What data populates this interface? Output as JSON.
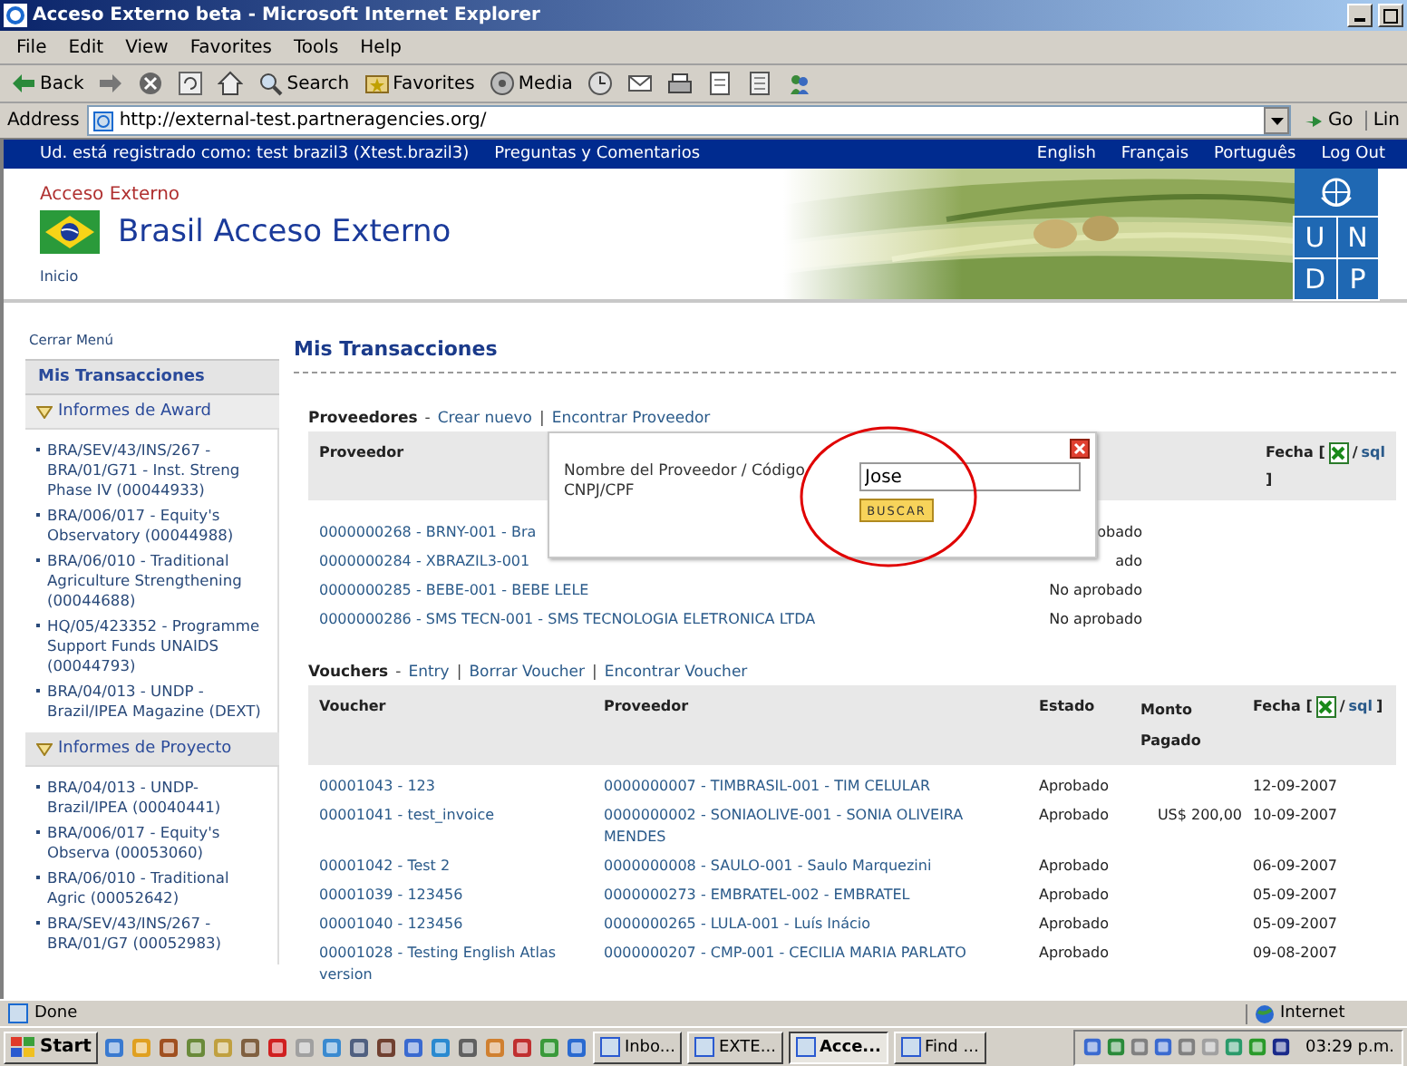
{
  "window": {
    "title": "Acceso Externo beta - Microsoft Internet Explorer"
  },
  "menu": [
    "File",
    "Edit",
    "View",
    "Favorites",
    "Tools",
    "Help"
  ],
  "toolbar": [
    {
      "kind": "back",
      "label": "Back"
    },
    {
      "kind": "forward"
    },
    {
      "kind": "stop"
    },
    {
      "kind": "refresh"
    },
    {
      "kind": "home"
    },
    {
      "kind": "search",
      "label": "Search"
    },
    {
      "kind": "favorites",
      "label": "Favorites"
    },
    {
      "kind": "media",
      "label": "Media"
    },
    {
      "kind": "history"
    },
    {
      "kind": "mail"
    },
    {
      "kind": "print"
    },
    {
      "kind": "edit"
    },
    {
      "kind": "discuss"
    },
    {
      "kind": "messenger"
    }
  ],
  "address": {
    "label": "Address",
    "url": "http://external-test.partneragencies.org/",
    "go": "Go",
    "links": "Lin"
  },
  "topnav": {
    "user": "Ud. está registrado como: test brazil3 (Xtest.brazil3)",
    "help": "Preguntas y Comentarios",
    "links": [
      "English",
      "Français",
      "Português",
      "Log Out"
    ]
  },
  "header": {
    "subtitle": "Acceso Externo",
    "title": "Brasil Acceso Externo",
    "breadcrumb": "Inicio",
    "logo": [
      "U",
      "N",
      "D",
      "P"
    ]
  },
  "sidebar": {
    "toggle": "Cerrar Menú",
    "title": "Mis Transacciones",
    "sections": [
      {
        "title": "Informes de Award",
        "expanded": true,
        "items": [
          "BRA/SEV/43/INS/267 - BRA/01/G71 - Inst. Streng Phase IV (00044933)",
          "BRA/006/017 - Equity's Observatory (00044988)",
          "BRA/06/010 - Traditional Agriculture Strengthening (00044688)",
          "HQ/05/423352 - Programme Support Funds UNAIDS (00044793)",
          "BRA/04/013 - UNDP - Brazil/IPEA Magazine (DEXT)"
        ]
      },
      {
        "title": "Informes de Proyecto",
        "expanded": true,
        "items": [
          "BRA/04/013 - UNDP-Brazil/IPEA (00040441)",
          "BRA/006/017 - Equity's Observa (00053060)",
          "BRA/06/010 - Traditional Agric (00052642)",
          "BRA/SEV/43/INS/267 - BRA/01/G7 (00052983)"
        ]
      }
    ]
  },
  "page_title": "Mis Transacciones",
  "vendors": {
    "title": "Proveedores",
    "dash": "-",
    "separator": "|",
    "links": [
      "Crear nuevo",
      "Encontrar Proveedor"
    ],
    "columns": {
      "vendor": "Proveedor",
      "date": "Fecha [",
      "date_sep": "/",
      "sql": "sql",
      "date_end": "]"
    },
    "rows": [
      {
        "vendor": "0000000268 - BRNY-001 - Bra",
        "status": "obado"
      },
      {
        "vendor": "0000000284 - XBRAZIL3-001",
        "status": "ado"
      },
      {
        "vendor": "0000000285 - BEBE-001 - BEBE LELE",
        "status": "No aprobado"
      },
      {
        "vendor": "0000000286 - SMS TECN-001 - SMS TECNOLOGIA ELETRONICA LTDA",
        "status": "No aprobado"
      }
    ]
  },
  "vouchers": {
    "title": "Vouchers",
    "dash": "-",
    "separator": "|",
    "links": [
      "Entry",
      "Borrar Voucher",
      "Encontrar Voucher"
    ],
    "columns": {
      "voucher": "Voucher",
      "vendor": "Proveedor",
      "status": "Estado",
      "amount": "Monto Pagado",
      "date": "Fecha [",
      "date_sep": "/",
      "sql": "sql",
      "date_end": "]"
    },
    "rows": [
      {
        "voucher": "00001043 - 123",
        "vendor": "0000000007 - TIMBRASIL-001 - TIM CELULAR",
        "status": "Aprobado",
        "date": "12-09-2007"
      },
      {
        "voucher": "00001041 - test_invoice",
        "vendor": "0000000002 - SONIAOLIVE-001 - SONIA OLIVEIRA MENDES",
        "status": "Aprobado",
        "amount": "US$ 200,00",
        "date": "10-09-2007"
      },
      {
        "voucher": "00001042 - Test 2",
        "vendor": "0000000008 - SAULO-001 - Saulo Marquezini",
        "status": "Aprobado",
        "date": "06-09-2007"
      },
      {
        "voucher": "00001039 - 123456",
        "vendor": "0000000273 - EMBRATEL-002 - EMBRATEL",
        "status": "Aprobado",
        "date": "05-09-2007"
      },
      {
        "voucher": "00001040 - 123456",
        "vendor": "0000000265 - LULA-001 - Luís Inácio",
        "status": "Aprobado",
        "date": "05-09-2007"
      },
      {
        "voucher": "00001028 - Testing English Atlas version",
        "vendor": "0000000207 - CMP-001 - CECILIA MARIA PARLATO",
        "status": "Aprobado",
        "date": "09-08-2007"
      }
    ]
  },
  "dialog": {
    "label": "Nombre del Proveedor / Código CNPJ/CPF",
    "value": "Jose",
    "button": "BUSCAR"
  },
  "status_bar": {
    "text": "Done",
    "zone": "Internet"
  },
  "taskbar": {
    "start": "Start",
    "tasks": [
      {
        "label": "Inbo...",
        "selected": false
      },
      {
        "label": "EXTE...",
        "selected": false
      },
      {
        "label": "Acce...",
        "selected": true
      },
      {
        "label": "Find ...",
        "selected": false
      }
    ],
    "clock": "03:29 p.m."
  }
}
